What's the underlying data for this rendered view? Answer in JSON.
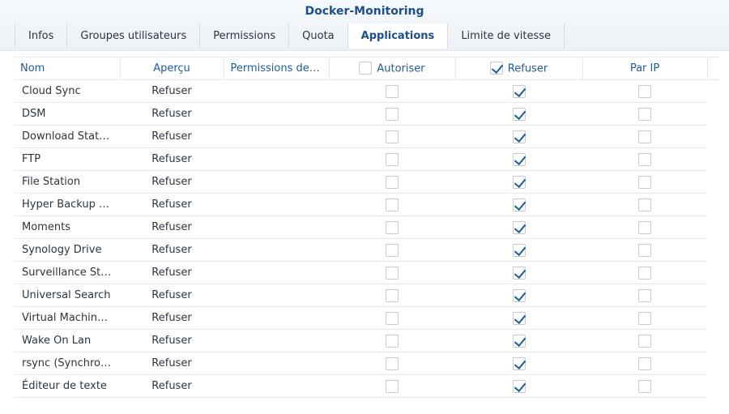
{
  "window": {
    "title": "Docker-Monitoring"
  },
  "tabs": [
    {
      "label": "Infos",
      "active": false
    },
    {
      "label": "Groupes utilisateurs",
      "active": false
    },
    {
      "label": "Permissions",
      "active": false
    },
    {
      "label": "Quota",
      "active": false
    },
    {
      "label": "Applications",
      "active": true
    },
    {
      "label": "Limite de vitesse",
      "active": false
    }
  ],
  "table": {
    "headers": {
      "name": "Nom",
      "preview": "Aperçu",
      "group_permissions": "Permissions des …",
      "allow": "Autoriser",
      "deny": "Refuser",
      "by_ip": "Par IP"
    },
    "header_checks": {
      "allow": false,
      "deny": true
    },
    "rows": [
      {
        "name": "Cloud Sync",
        "preview": "Refuser",
        "group": "",
        "allow": false,
        "deny": true,
        "by_ip": false
      },
      {
        "name": "DSM",
        "preview": "Refuser",
        "group": "",
        "allow": false,
        "deny": true,
        "by_ip": false
      },
      {
        "name": "Download Station",
        "preview": "Refuser",
        "group": "",
        "allow": false,
        "deny": true,
        "by_ip": false
      },
      {
        "name": "FTP",
        "preview": "Refuser",
        "group": "",
        "allow": false,
        "deny": true,
        "by_ip": false
      },
      {
        "name": "File Station",
        "preview": "Refuser",
        "group": "",
        "allow": false,
        "deny": true,
        "by_ip": false
      },
      {
        "name": "Hyper Backup V…",
        "preview": "Refuser",
        "group": "",
        "allow": false,
        "deny": true,
        "by_ip": false
      },
      {
        "name": "Moments",
        "preview": "Refuser",
        "group": "",
        "allow": false,
        "deny": true,
        "by_ip": false
      },
      {
        "name": "Synology Drive",
        "preview": "Refuser",
        "group": "",
        "allow": false,
        "deny": true,
        "by_ip": false
      },
      {
        "name": "Surveillance Sta…",
        "preview": "Refuser",
        "group": "",
        "allow": false,
        "deny": true,
        "by_ip": false
      },
      {
        "name": "Universal Search",
        "preview": "Refuser",
        "group": "",
        "allow": false,
        "deny": true,
        "by_ip": false
      },
      {
        "name": "Virtual Machine …",
        "preview": "Refuser",
        "group": "",
        "allow": false,
        "deny": true,
        "by_ip": false
      },
      {
        "name": "Wake On Lan",
        "preview": "Refuser",
        "group": "",
        "allow": false,
        "deny": true,
        "by_ip": false
      },
      {
        "name": "rsync (Synchron…",
        "preview": "Refuser",
        "group": "",
        "allow": false,
        "deny": true,
        "by_ip": false
      },
      {
        "name": "Éditeur de texte",
        "preview": "Refuser",
        "group": "",
        "allow": false,
        "deny": true,
        "by_ip": false
      }
    ]
  },
  "colors": {
    "accent": "#1f5a9c",
    "title": "#1f4e8c",
    "border": "#e6eaf0",
    "checkbox_border": "#c4cbd4"
  },
  "icons": {
    "checked": "checkmark-icon"
  }
}
